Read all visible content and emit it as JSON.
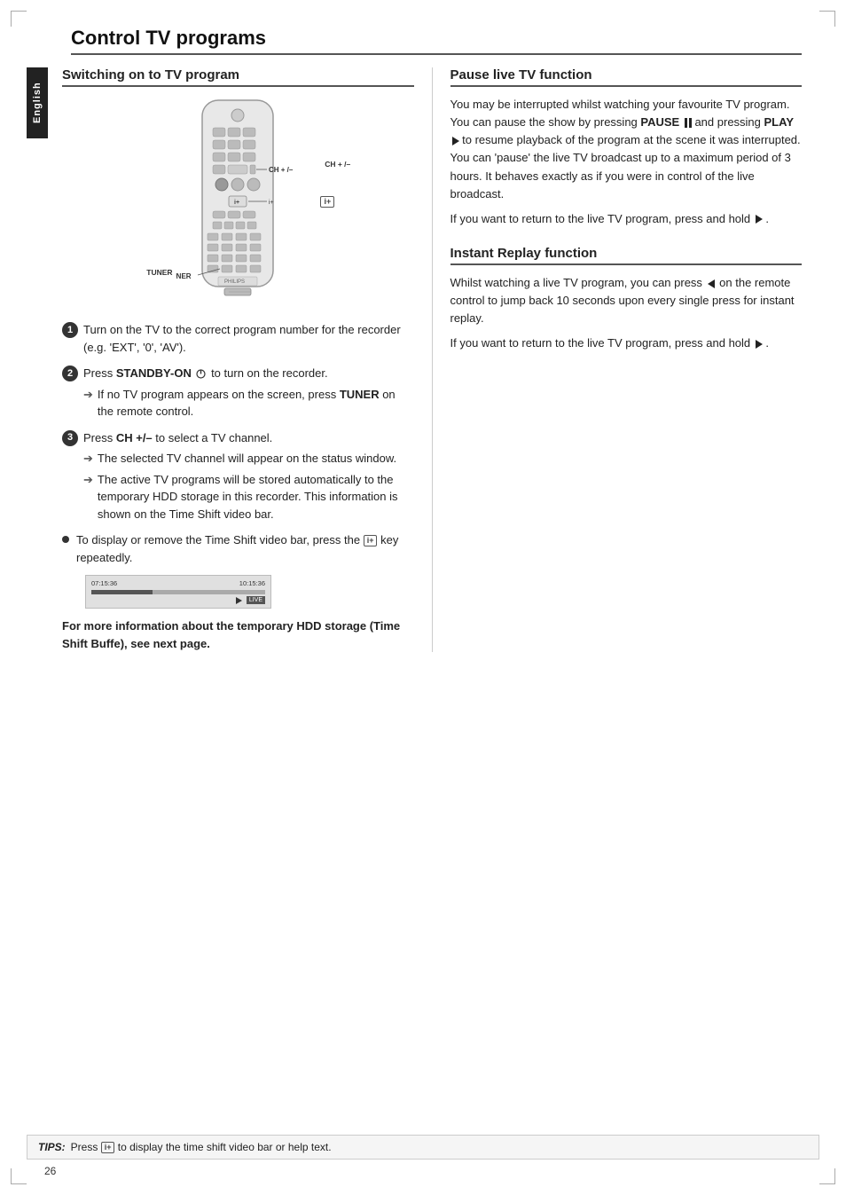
{
  "page": {
    "title": "Control TV programs",
    "page_number": "26"
  },
  "english_tab": "English",
  "left_section": {
    "title": "Switching on to TV program",
    "remote_labels": {
      "ch_label": "CH + /–",
      "iplus_label": "i+",
      "tuner_label": "TUNER"
    },
    "instructions": [
      {
        "num": "1",
        "text": "Turn on the TV to the correct program number for the recorder (e.g. 'EXT', '0', 'AV')."
      },
      {
        "num": "2",
        "text_before": "Press ",
        "bold_text": "STANDBY-ON",
        "text_after": " to turn on the recorder.",
        "sub_items": [
          "If no TV program appears on the screen, press TUNER on the remote control."
        ]
      },
      {
        "num": "3",
        "text_before": "Press ",
        "bold_text": "CH +/–",
        "text_after": " to select a TV channel.",
        "sub_items": [
          "The selected TV channel will appear on the status window.",
          "The active TV programs will be stored automatically to the temporary HDD storage in this recorder. This information is shown on the Time Shift video bar."
        ]
      }
    ],
    "bullet_item": {
      "text_before": "To display or remove the Time Shift video bar, press the ",
      "text_after": " key repeatedly."
    },
    "video_bar": {
      "time_start": "07:15:36",
      "time_end": "10:15:36",
      "live_label": "LIVE"
    },
    "note_bold": "For more information about the temporary HDD storage (Time Shift Buffe), see next page."
  },
  "right_section": {
    "pause_title": "Pause live TV function",
    "pause_paragraphs": [
      "You may be interrupted whilst watching your favourite TV program.  You can pause the show by pressing PAUSE and pressing PLAY ▶ to resume playback of the program at the scene it was interrupted. You can 'pause' the live TV broadcast up to a maximum period of 3 hours. It behaves exactly as if you were in control of the live broadcast.",
      "If you want to return to the live TV program, press and hold ▶ ."
    ],
    "instant_title": "Instant Replay function",
    "instant_paragraphs": [
      "Whilst watching a live TV program, you can press ◀ on the remote control to jump back 10 seconds upon every single press for instant replay.",
      "If you want to return to the live TV program, press and hold ▶ ."
    ]
  },
  "tips": {
    "label": "TIPS:",
    "text": "Press",
    "iplus": "i+",
    "text2": "to display the time shift video bar or help text."
  }
}
